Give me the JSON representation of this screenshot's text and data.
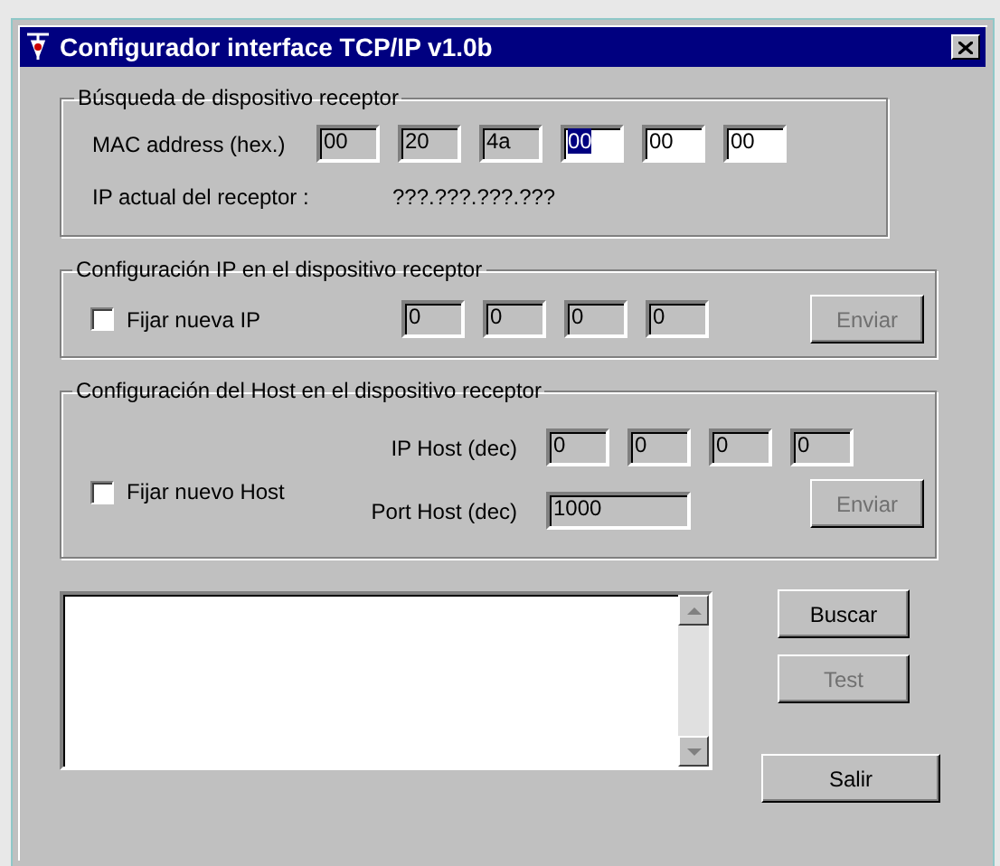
{
  "window": {
    "title": "Configurador interface TCP/IP v1.0b"
  },
  "mac_search": {
    "title": "Búsqueda de dispositivo receptor",
    "mac_label": "MAC address (hex.)",
    "mac_fields": [
      {
        "value": "00",
        "disabled": true,
        "selected": false
      },
      {
        "value": "20",
        "disabled": true,
        "selected": false
      },
      {
        "value": "4a",
        "disabled": true,
        "selected": false
      },
      {
        "value": "00",
        "disabled": false,
        "selected": true
      },
      {
        "value": "00",
        "disabled": false,
        "selected": false
      },
      {
        "value": "00",
        "disabled": false,
        "selected": false
      }
    ],
    "ip_label": "IP actual del receptor :",
    "ip_value": "???.???.???.???"
  },
  "ip_config": {
    "title": "Configuración IP en el dispositivo receptor",
    "checkbox": {
      "label": "Fijar nueva IP",
      "checked": false
    },
    "fields": [
      {
        "value": "0",
        "disabled": true
      },
      {
        "value": "0",
        "disabled": true
      },
      {
        "value": "0",
        "disabled": true
      },
      {
        "value": "0",
        "disabled": true
      }
    ],
    "send_button": {
      "label": "Enviar",
      "disabled": true
    }
  },
  "host_config": {
    "title": "Configuración del Host en el dispositivo receptor",
    "checkbox": {
      "label": "Fijar nuevo Host",
      "checked": false
    },
    "ip_label": "IP Host (dec)",
    "fields": [
      {
        "value": "0",
        "disabled": true
      },
      {
        "value": "0",
        "disabled": true
      },
      {
        "value": "0",
        "disabled": true
      },
      {
        "value": "0",
        "disabled": true
      }
    ],
    "port_label": "Port Host (dec)",
    "port_field": {
      "value": "1000",
      "disabled": true
    },
    "send_button": {
      "label": "Enviar",
      "disabled": true
    }
  },
  "buttons": [
    {
      "label": "Buscar",
      "disabled": false
    },
    {
      "label": "Test",
      "disabled": true
    },
    {
      "label": "Salir",
      "disabled": false
    }
  ]
}
